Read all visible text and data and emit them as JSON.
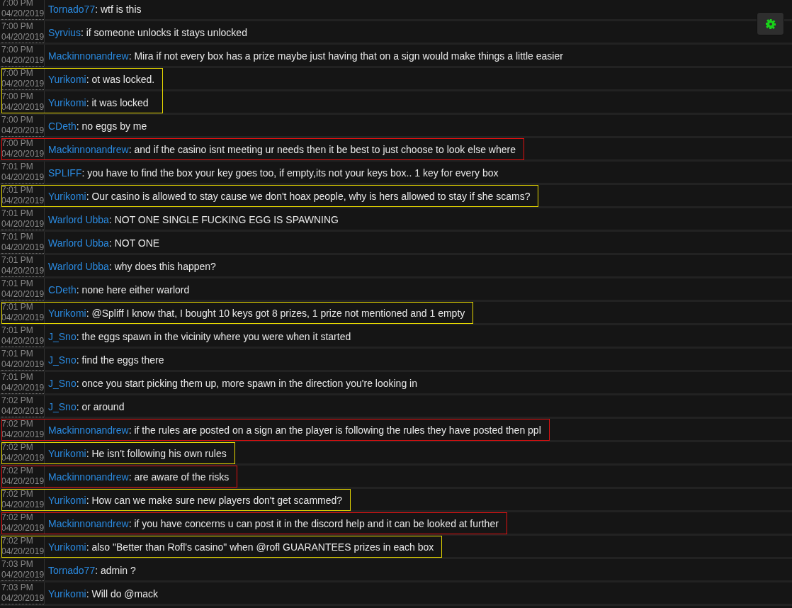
{
  "groups": [
    {
      "messages": [
        {
          "time": "7:00 PM",
          "date": "04/20/2019",
          "user": "Tornado77",
          "text": ": wtf is this"
        }
      ]
    },
    {
      "messages": [
        {
          "time": "7:00 PM",
          "date": "04/20/2019",
          "user": "Syrvius",
          "text": ": if someone unlocks it stays unlocked"
        }
      ]
    },
    {
      "messages": [
        {
          "time": "7:00 PM",
          "date": "04/20/2019",
          "user": "Mackinnonandrew",
          "text": ": Mira if not every box has a prize maybe just having that on a sign would make things a little easier"
        }
      ]
    },
    {
      "color": "#e6d800",
      "messages": [
        {
          "time": "7:00 PM",
          "date": "04/20/2019",
          "user": "Yurikomi",
          "text": ": ot was locked."
        },
        {
          "time": "7:00 PM",
          "date": "04/20/2019",
          "user": "Yurikomi",
          "text": ": it was locked"
        }
      ]
    },
    {
      "messages": [
        {
          "time": "7:00 PM",
          "date": "04/20/2019",
          "user": "CDeth",
          "text": ": no eggs by me"
        }
      ]
    },
    {
      "color": "#e01010",
      "messages": [
        {
          "time": "7:00 PM",
          "date": "04/20/2019",
          "user": "Mackinnonandrew",
          "text": ": and if the casino isnt meeting ur needs then it be best to just choose to look else where"
        }
      ]
    },
    {
      "messages": [
        {
          "time": "7:01 PM",
          "date": "04/20/2019",
          "user": "SPLIFF",
          "text": ": you have to find the box your key goes too, if empty,its not your keys box.. 1 key for every box"
        }
      ]
    },
    {
      "color": "#e6d800",
      "messages": [
        {
          "time": "7:01 PM",
          "date": "04/20/2019",
          "user": "Yurikomi",
          "text": ": Our casino is allowed to stay cause we don't hoax people, why is hers allowed to stay if she scams?"
        }
      ]
    },
    {
      "messages": [
        {
          "time": "7:01 PM",
          "date": "04/20/2019",
          "user": "Warlord Ubba",
          "text": ": NOT ONE SINGLE FUCKING EGG IS SPAWNING"
        }
      ]
    },
    {
      "messages": [
        {
          "time": "7:01 PM",
          "date": "04/20/2019",
          "user": "Warlord Ubba",
          "text": ": NOT ONE"
        }
      ]
    },
    {
      "messages": [
        {
          "time": "7:01 PM",
          "date": "04/20/2019",
          "user": "Warlord Ubba",
          "text": ": why does this happen?"
        }
      ]
    },
    {
      "messages": [
        {
          "time": "7:01 PM",
          "date": "04/20/2019",
          "user": "CDeth",
          "text": ": none here either warlord"
        }
      ]
    },
    {
      "color": "#e6d800",
      "messages": [
        {
          "time": "7:01 PM",
          "date": "04/20/2019",
          "user": "Yurikomi",
          "text": ": @Spliff I know that, I bought 10 keys got 8 prizes, 1 prize not mentioned and 1 empty"
        }
      ]
    },
    {
      "messages": [
        {
          "time": "7:01 PM",
          "date": "04/20/2019",
          "user": "J_Sno",
          "text": ": the eggs spawn in the vicinity where you were when it started"
        }
      ]
    },
    {
      "messages": [
        {
          "time": "7:01 PM",
          "date": "04/20/2019",
          "user": "J_Sno",
          "text": ": find the eggs there"
        }
      ]
    },
    {
      "messages": [
        {
          "time": "7:01 PM",
          "date": "04/20/2019",
          "user": "J_Sno",
          "text": ": once you start picking them up, more spawn in the direction you're looking in"
        }
      ]
    },
    {
      "messages": [
        {
          "time": "7:02 PM",
          "date": "04/20/2019",
          "user": "J_Sno",
          "text": ": or around"
        }
      ]
    },
    {
      "color": "#e01010",
      "messages": [
        {
          "time": "7:02 PM",
          "date": "04/20/2019",
          "user": "Mackinnonandrew",
          "text": ": if the rules are posted on a sign an the player is following the rules they have posted then ppl"
        }
      ]
    },
    {
      "color": "#e6d800",
      "messages": [
        {
          "time": "7:02 PM",
          "date": "04/20/2019",
          "user": "Yurikomi",
          "text": ": He isn't following his own rules"
        }
      ]
    },
    {
      "color": "#e01010",
      "messages": [
        {
          "time": "7:02 PM",
          "date": "04/20/2019",
          "user": "Mackinnonandrew",
          "text": ": are aware of the risks"
        }
      ]
    },
    {
      "color": "#e6d800",
      "messages": [
        {
          "time": "7:02 PM",
          "date": "04/20/2019",
          "user": "Yurikomi",
          "text": ": How can we make sure new players don't get scammed?"
        }
      ]
    },
    {
      "color": "#e01010",
      "messages": [
        {
          "time": "7:02 PM",
          "date": "04/20/2019",
          "user": "Mackinnonandrew",
          "text": ": if you have concerns u can post it in the discord help and it can be looked at further"
        }
      ]
    },
    {
      "color": "#e6d800",
      "messages": [
        {
          "time": "7:02 PM",
          "date": "04/20/2019",
          "user": "Yurikomi",
          "text": ": also \"Better than Rofl's casino\" when @rofl GUARANTEES prizes in each box"
        }
      ]
    },
    {
      "messages": [
        {
          "time": "7:03 PM",
          "date": "04/20/2019",
          "user": "Tornado77",
          "text": ": admin ?"
        }
      ]
    },
    {
      "messages": [
        {
          "time": "7:03 PM",
          "date": "04/20/2019",
          "user": "Yurikomi",
          "text": ": Will do @mack"
        }
      ]
    }
  ]
}
